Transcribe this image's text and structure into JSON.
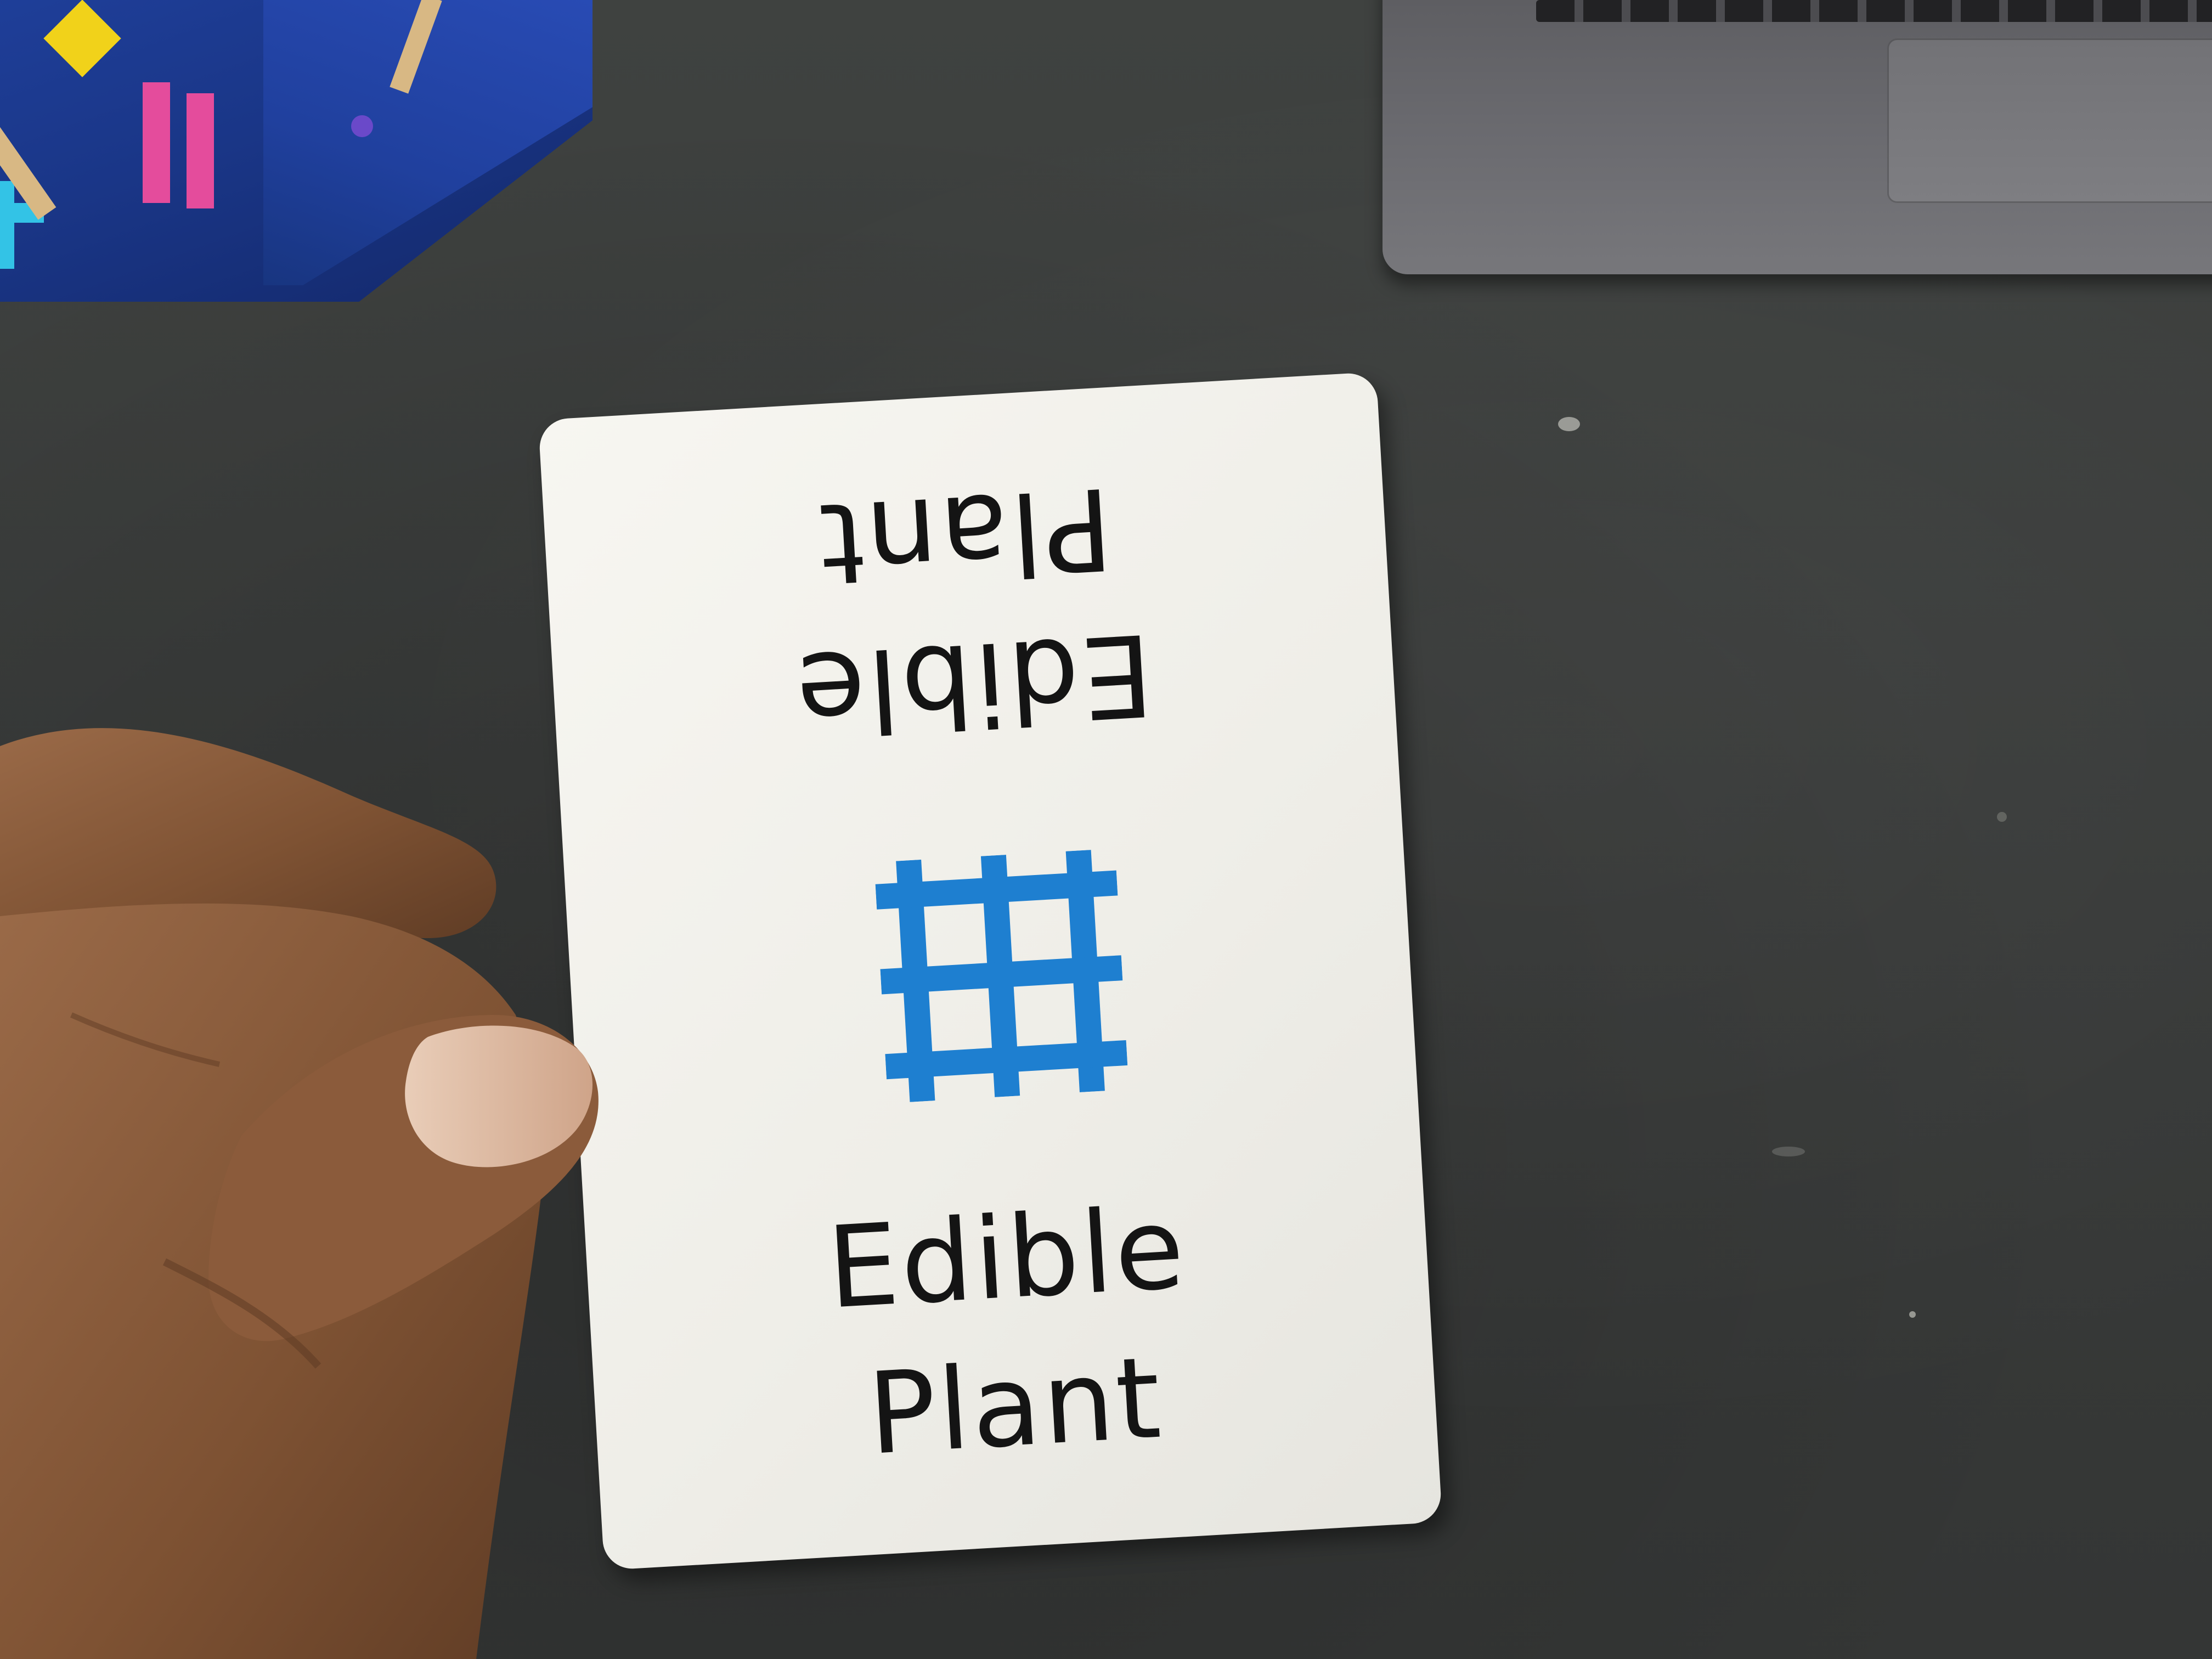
{
  "card": {
    "upside_down_text": [
      "Edible",
      "Plant"
    ],
    "upright_text": [
      "Edible",
      "Plant"
    ],
    "icon": "grid-hash-icon",
    "icon_color": "#1e7fd0",
    "text_color": "#141414",
    "card_color": "#f2f1ec"
  },
  "background": {
    "desk_color": "#3b3d3c",
    "box_color": "#1f3f9a",
    "laptop_color": "#6b6b70",
    "skin_color": "#8a5a3a"
  }
}
